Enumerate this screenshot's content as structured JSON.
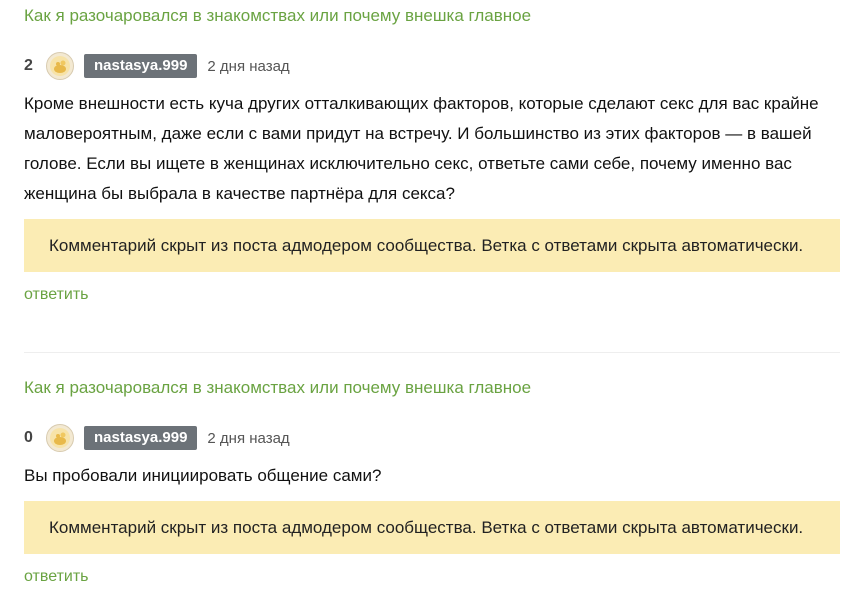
{
  "comments": [
    {
      "post_title": "Как я разочаровался в знакомствах или почему внешка главное",
      "rating": "2",
      "username": "nastasya.999",
      "time": "2 дня назад",
      "text": "Кроме внешности есть куча других отталкивающих факторов, которые сделают секс для вас крайне маловероятным, даже если с вами придут на встречу. И большинство из этих факторов — в вашей голове. Если вы ищете в женщинах исключительно секс, ответьте сами себе, почему именно вас женщина бы выбрала в качестве партнёра для секса?",
      "hidden_notice": "Комментарий скрыт из поста адмодером сообщества. Ветка с ответами скрыта автоматически.",
      "reply_label": "ответить"
    },
    {
      "post_title": "Как я разочаровался в знакомствах или почему внешка главное",
      "rating": "0",
      "username": "nastasya.999",
      "time": "2 дня назад",
      "text": "Вы пробовали инициировать общение сами?",
      "hidden_notice": "Комментарий скрыт из поста адмодером сообщества. Ветка с ответами скрыта автоматически.",
      "reply_label": "ответить"
    }
  ],
  "colors": {
    "link": "#6aa342",
    "notice_bg": "#fbecb4",
    "username_bg": "#6c7278"
  },
  "icons": {
    "avatar": "avatar-icon"
  }
}
